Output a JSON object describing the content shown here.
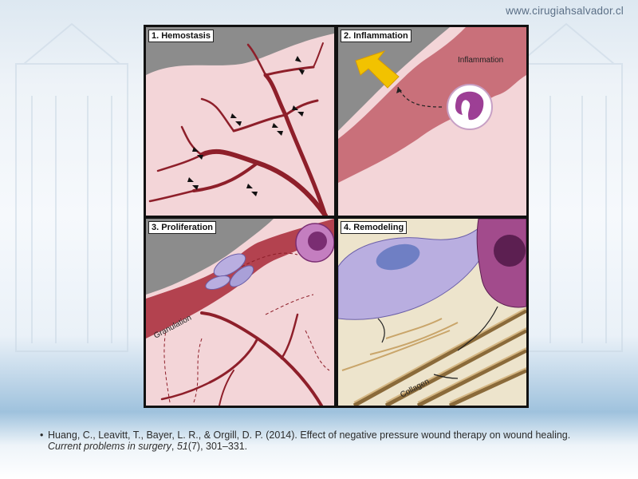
{
  "header": {
    "site_url": "www.cirugiahsalvador.cl"
  },
  "panels": [
    {
      "label": "1. Hemostasis"
    },
    {
      "label": "2. Inflammation",
      "annotation": "Inflammation"
    },
    {
      "label": "3. Proliferation",
      "annotation": "Granulation"
    },
    {
      "label": "4. Remodeling",
      "annotation": "Collagen"
    }
  ],
  "citation": {
    "bullet": "•",
    "authors": "Huang, C., Leavitt, T., Bayer, L. R., & Orgill, D. P. (2014). Effect of negative pressure wound therapy on wound healing. ",
    "journal": "Current problems in surgery",
    "separator1": ", ",
    "volume": "51",
    "issue": "(7)",
    "pages": ", 301–331."
  },
  "colors": {
    "vessel": "#8e1f2a",
    "tissue": "#f3d5d8",
    "wound_gray": "#8c8c8c",
    "inflammation_band": "#c9707a",
    "arrow_yellow": "#f2c200",
    "cell_purple": "#9d3f95",
    "fibroblast": "#b9aee0",
    "collagen": "#c9a56a"
  },
  "icons": [
    "yellow-arrow-icon",
    "leukocyte-icon",
    "fibroblast-icon",
    "collagen-fiber-icon"
  ]
}
